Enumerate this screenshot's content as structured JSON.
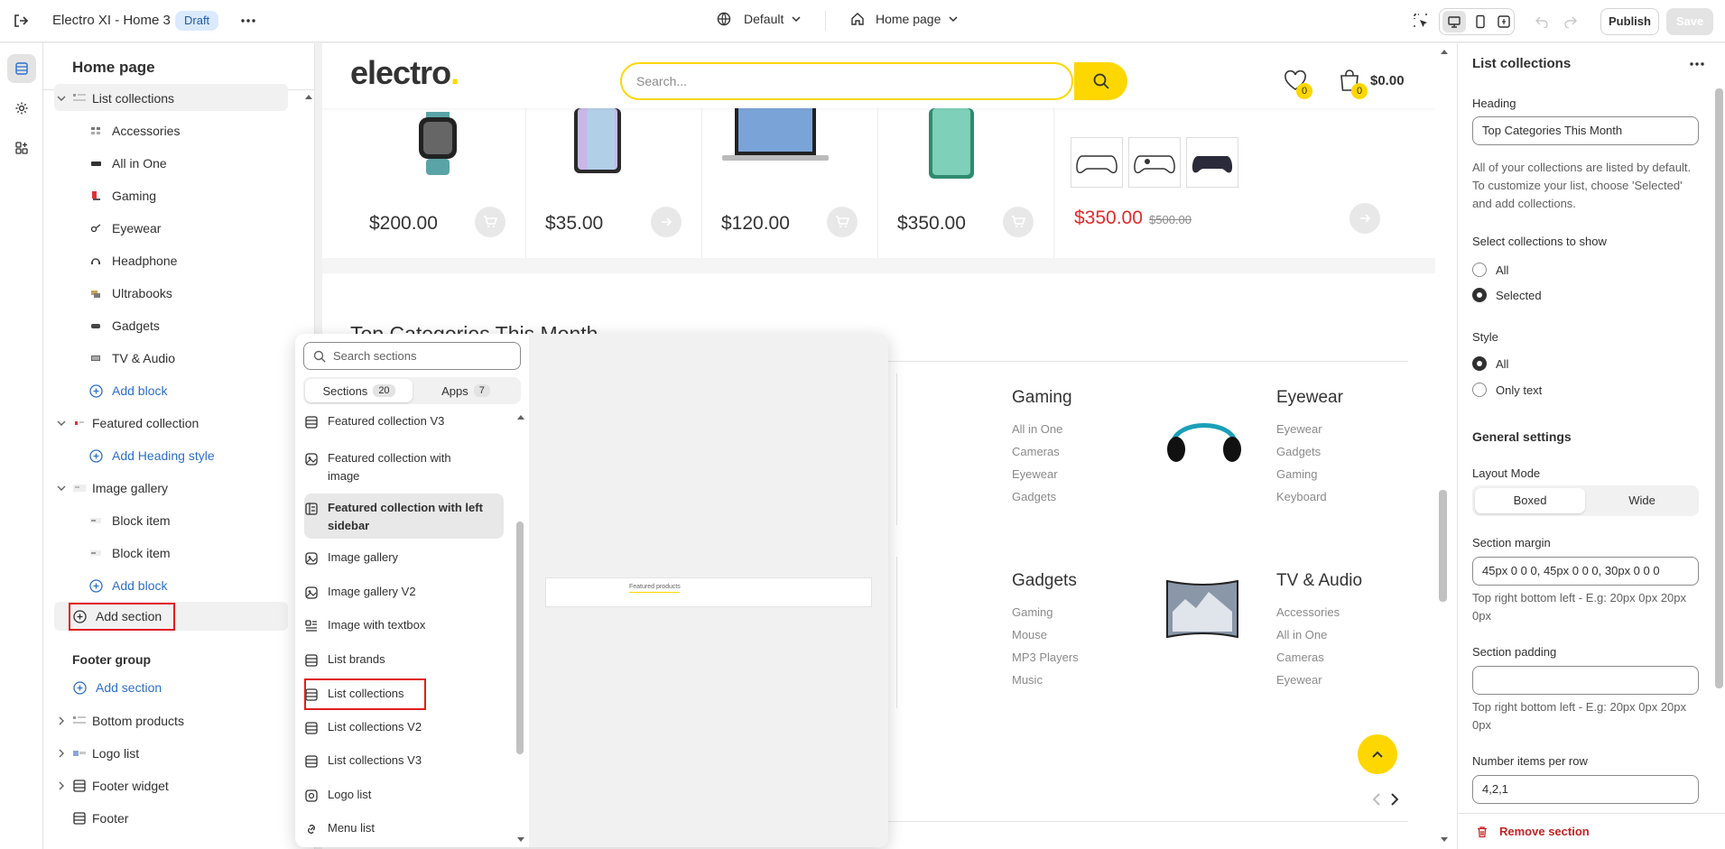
{
  "topbar": {
    "store_title": "Electro XI - Home 3",
    "status_badge": "Draft",
    "theme_select": "Default",
    "page_select": "Home page",
    "publish_label": "Publish",
    "save_label": "Save"
  },
  "left_panel": {
    "title": "Home page",
    "current_section": "List collections",
    "blocks": [
      "Accessories",
      "All in One",
      "Gaming",
      "Eyewear",
      "Headphone",
      "Ultrabooks",
      "Gadgets",
      "TV & Audio"
    ],
    "add_block": "Add block",
    "featured_collection": "Featured collection",
    "add_heading_style": "Add Heading style",
    "image_gallery": "Image gallery",
    "block_item_1": "Block item",
    "block_item_2": "Block item",
    "add_block_2": "Add block",
    "add_section": "Add section",
    "footer_group": "Footer group",
    "footer_add_section": "Add section",
    "bottom_products": "Bottom products",
    "logo_list": "Logo list",
    "footer_widget": "Footer widget",
    "footer": "Footer"
  },
  "preview": {
    "logo": "electro",
    "search_placeholder": "Search...",
    "wishlist_count": "0",
    "cart_count": "0",
    "cart_total": "$0.00",
    "prices": [
      "$200.00",
      "$35.00",
      "$120.00",
      "$350.00"
    ],
    "sale_price": "$350.00",
    "old_price": "$500.00",
    "section_heading": "Top Categories This Month",
    "thumb_caption": "Featured products",
    "categories": [
      {
        "title": "Gaming",
        "links": [
          "All in One",
          "Cameras",
          "Eyewear",
          "Gadgets"
        ]
      },
      {
        "title": "Eyewear",
        "links": [
          "Eyewear",
          "Gadgets",
          "Gaming",
          "Keyboard"
        ]
      },
      {
        "title": "Gadgets",
        "links": [
          "Gaming",
          "Mouse",
          "MP3 Players",
          "Music"
        ]
      },
      {
        "title": "TV & Audio",
        "links": [
          "Accessories",
          "All in One",
          "Cameras",
          "Eyewear"
        ]
      }
    ]
  },
  "popup": {
    "search_placeholder": "Search sections",
    "tab_sections": "Sections",
    "tab_sections_count": "20",
    "tab_apps": "Apps",
    "tab_apps_count": "7",
    "items": [
      "Featured collection V3",
      "Featured collection with image",
      "Featured collection with left sidebar",
      "Image gallery",
      "Image gallery V2",
      "Image with textbox",
      "List brands",
      "List collections",
      "List collections V2",
      "List collections V3",
      "Logo list",
      "Menu list"
    ]
  },
  "right_panel": {
    "title": "List collections",
    "heading_label": "Heading",
    "heading_value": "Top Categories This Month",
    "heading_help": "All of your collections are listed by default. To customize your list, choose 'Selected' and add collections.",
    "select_label": "Select collections to show",
    "opt_all": "All",
    "opt_selected": "Selected",
    "style_label": "Style",
    "style_all": "All",
    "style_only_text": "Only text",
    "general_settings": "General settings",
    "layout_mode_label": "Layout Mode",
    "layout_boxed": "Boxed",
    "layout_wide": "Wide",
    "section_margin_label": "Section margin",
    "section_margin_value": "45px 0 0 0, 45px 0 0 0, 30px 0 0 0",
    "margin_help": "Top right bottom left - E.g: 20px 0px 20px 0px",
    "section_padding_label": "Section padding",
    "section_padding_value": "",
    "padding_help": "Top right bottom left - E.g: 20px 0px 20px 0px",
    "items_per_row_label": "Number items per row",
    "items_per_row_value": "4,2,1",
    "remove_section": "Remove section"
  },
  "colors": {
    "accent_yellow": "#fed700",
    "link_blue": "#2c6ecb",
    "sale_red": "#e22a2a",
    "highlight_red": "#e11d1d"
  }
}
